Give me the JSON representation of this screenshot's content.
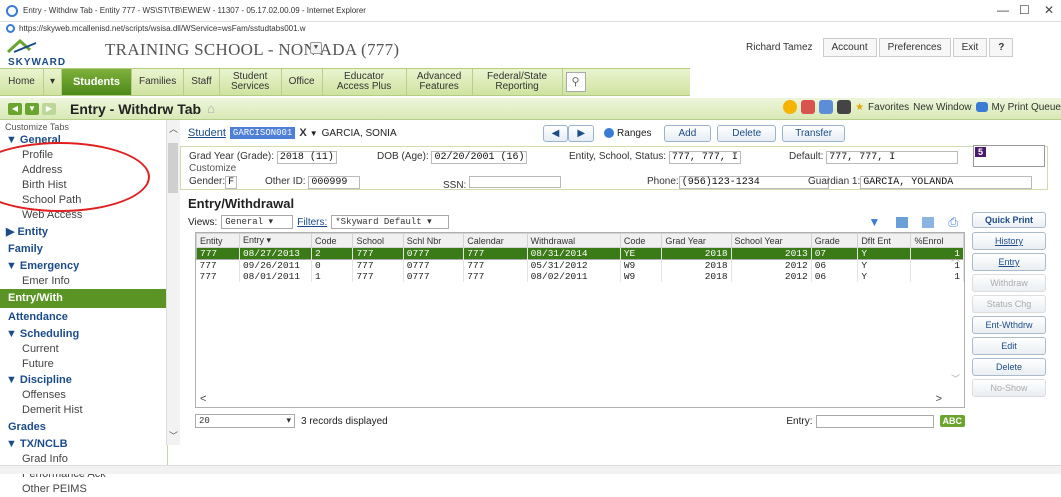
{
  "window": {
    "title": "Entry - Withdrw Tab - Entity 777 - WS\\ST\\TB\\EW\\EW - 11307 - 05.17.02.00.09 - Internet Explorer",
    "url": "https://skyweb.mcallenisd.net/scripts/wsisa.dll/WService=wsFam/sstudtabs001.w",
    "min": "—",
    "max": "☐",
    "close": "✕"
  },
  "brand": {
    "logo": "SKYWARD",
    "school": "TRAINING SCHOOL - NON ADA (777)"
  },
  "user": {
    "name": "Richard Tamez",
    "account": "Account",
    "preferences": "Preferences",
    "exit": "Exit",
    "help": "?"
  },
  "nav": {
    "home": "Home",
    "students": "Students",
    "families": "Families",
    "staff": "Staff",
    "student_services": "Student Services",
    "office": "Office",
    "educator": "Educator Access Plus",
    "advanced": "Advanced Features",
    "federal": "Federal/State Reporting"
  },
  "tab": {
    "title": "Entry - Withdrw Tab",
    "favorites": "Favorites",
    "new_window": "New Window",
    "print_queue": "My Print Queue"
  },
  "sidebar": {
    "customize": "Customize Tabs",
    "general": "General",
    "profile": "Profile",
    "address": "Address",
    "birth": "Birth Hist",
    "school_path": "School Path",
    "web_access": "Web Access",
    "entity": "Entity",
    "family": "Family",
    "emergency": "Emergency",
    "emer_info": "Emer Info",
    "entry_with": "Entry/With",
    "attendance": "Attendance",
    "scheduling": "Scheduling",
    "current": "Current",
    "future": "Future",
    "discipline": "Discipline",
    "offenses": "Offenses",
    "demerit": "Demerit Hist",
    "grades": "Grades",
    "txnclb": "TX/NCLB",
    "grad_info": "Grad Info",
    "perf_ack": "Performance Ack",
    "other_peims": "Other PEIMS"
  },
  "student": {
    "label": "Student",
    "id": "GARCISON001",
    "x": "X",
    "name": "GARCIA, SONIA",
    "ranges": "Ranges",
    "add": "Add",
    "delete": "Delete",
    "transfer": "Transfer"
  },
  "info": {
    "grad_year_label": "Grad Year (Grade):",
    "grad_year": "2018 (11)",
    "dob_label": "DOB (Age):",
    "dob": "02/20/2001 (16)",
    "ess_label": "Entity, School, Status:",
    "ess": "777, 777, I",
    "default_label": "Default:",
    "default": "777, 777, I",
    "badge": "5",
    "customize": "Customize",
    "gender_label": "Gender:",
    "gender": "F",
    "other_label": "Other ID:",
    "other": "000999",
    "ssn_label": "SSN:",
    "ssn": "",
    "phone_label": "Phone:",
    "phone": "(956)123-1234",
    "guardian_label": "Guardian 1:",
    "guardian": "GARCIA, YOLANDA"
  },
  "section": {
    "title": "Entry/Withdrawal",
    "views_label": "Views:",
    "views": "General",
    "filters_label": "Filters:",
    "filters": "*Skyward Default"
  },
  "table": {
    "headers": [
      "Entity",
      "Entry",
      "Code",
      "School",
      "Schl Nbr",
      "Calendar",
      "Withdrawal",
      "Code",
      "Grad Year",
      "School Year",
      "Grade",
      "Dflt Ent",
      "%Enrol"
    ],
    "rows": [
      [
        "777",
        "08/27/2013",
        "2",
        "777",
        "0777",
        "777",
        "08/31/2014",
        "YE",
        "2018",
        "2013",
        "07",
        "Y",
        "1"
      ],
      [
        "777",
        "09/26/2011",
        "0",
        "777",
        "0777",
        "777",
        "05/31/2012",
        "W9",
        "2018",
        "2012",
        "06",
        "Y",
        "1"
      ],
      [
        "777",
        "08/01/2011",
        "1",
        "777",
        "0777",
        "777",
        "08/02/2011",
        "W9",
        "2018",
        "2012",
        "06",
        "Y",
        "1"
      ]
    ]
  },
  "footer": {
    "pagesize": "20",
    "records": "3 records displayed",
    "entry_label": "Entry:",
    "abc": "ABC"
  },
  "buttons": {
    "quick_print": "Quick Print",
    "history": "History",
    "entry": "Entry",
    "withdraw": "Withdraw",
    "status_chg": "Status Chg",
    "ent_wthdrw": "Ent-Wthdrw",
    "edit": "Edit",
    "delete": "Delete",
    "no_show": "No-Show"
  },
  "colors": {
    "nav_active": "#4d8a1a",
    "selected_row": "#3a7a17",
    "link": "#1b4c8a"
  }
}
